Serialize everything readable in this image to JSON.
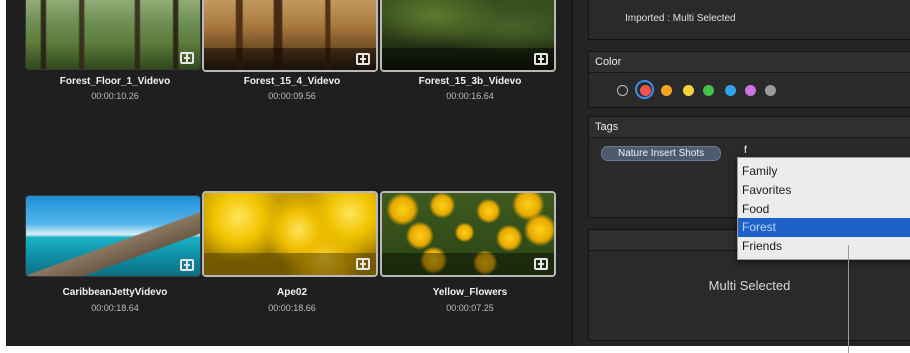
{
  "clips": [
    {
      "name": "Forest_Floor_1_Videvo",
      "duration": "00:00:10.26"
    },
    {
      "name": "Forest_15_4_Videvo",
      "duration": "00:00:09.56"
    },
    {
      "name": "Forest_15_3b_Videvo",
      "duration": "00:00:16.64"
    },
    {
      "name": "CaribbeanJettyVidevo",
      "duration": "00:00:18.64"
    },
    {
      "name": "Ape02",
      "duration": "00:00:18.66"
    },
    {
      "name": "Yellow_Flowers",
      "duration": "00:00:07.25"
    }
  ],
  "inspector": {
    "imported": "Imported : Multi Selected",
    "color_title": "Color",
    "swatch_colors": [
      "none",
      "#f2544f",
      "#f5a623",
      "#f5d33b",
      "#46c34a",
      "#2fa4e8",
      "#c876de",
      "#9b9b9b"
    ],
    "tags_title": "Tags",
    "tag_token": "Nature Insert Shots",
    "tag_typed": "f",
    "multi_selected": "Multi Selected"
  },
  "dropdown": {
    "items": [
      "Family",
      "Favorites",
      "Food",
      "Forest",
      "Friends"
    ],
    "highlighted": "Forest"
  }
}
